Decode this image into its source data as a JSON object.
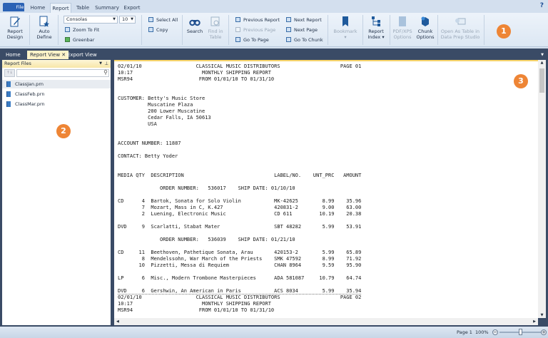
{
  "menu_tabs": [
    "File",
    "Home",
    "Report",
    "Table",
    "Summary",
    "Export"
  ],
  "active_menu_tab": "Report",
  "help_label": "?",
  "ribbon": {
    "report_design": "Report Design",
    "auto_define": "Auto Define",
    "font_name": "Consolas",
    "font_size": "10",
    "zoom_to_fit": "Zoom To Fit",
    "greenbar": "Greenbar",
    "select_all": "Select All",
    "copy": "Copy",
    "search": "Search",
    "find_in_table": "Find in Table",
    "previous_report": "Previous Report",
    "previous_page": "Previous Page",
    "go_to_page": "Go To Page",
    "next_report": "Next Report",
    "next_page": "Next Page",
    "go_to_chunk": "Go To Chunk",
    "bookmark": "Bookmark",
    "report_index": "Report Index",
    "pdf_xps_options": "PDF/XPS Options",
    "chunk_options": "Chunk Options",
    "open_as_table": "Open As Table in Data Prep Studio"
  },
  "doc_tabs": [
    "Home",
    "Report View",
    "Export View"
  ],
  "active_doc_tab": "Report View",
  "left_panel": {
    "title": "Report Files",
    "search_placeholder": "",
    "files": [
      "ClassJan.prn",
      "ClassFeb.prn",
      "ClassMar.prn"
    ],
    "selected": "ClassJan.prn"
  },
  "report": {
    "header": {
      "date": "02/01/10",
      "time": "10:17",
      "code": "MSR94",
      "company": "CLASSICAL MUSIC DISTRIBUTORS",
      "title": "MONTHLY SHIPPING REPORT",
      "range": "FROM 01/01/10 TO 01/31/10",
      "page1": "PAGE 01",
      "page2": "PAGE 02"
    },
    "customer_label": "CUSTOMER:",
    "customer": [
      "Betty's Music Store",
      "Muscatine Plaza",
      "200 Lower Muscatine",
      "Cedar Falls, IA 50613",
      "USA"
    ],
    "account": "ACCOUNT NUMBER: 11887",
    "contact": "CONTACT: Betty Yoder",
    "columns": {
      "media": "MEDIA",
      "qty": "QTY",
      "description": "DESCRIPTION",
      "label": "LABEL/NO.",
      "price": "UNT_PRC",
      "amount": "AMOUNT"
    },
    "orders": [
      {
        "order_number": "536017",
        "ship_date": "01/10/10",
        "groups": [
          {
            "media": "CD",
            "items": [
              {
                "qty": "4",
                "desc": "Bartok, Sonata for Solo Violin",
                "label": "MK-42625",
                "price": "8.99",
                "amount": "35.96"
              },
              {
                "qty": "7",
                "desc": "Mozart, Mass in C, K.427",
                "label": "420831-2",
                "price": "9.00",
                "amount": "63.00"
              },
              {
                "qty": "2",
                "desc": "Luening, Electronic Music",
                "label": "CD 611",
                "price": "10.19",
                "amount": "20.38"
              }
            ]
          },
          {
            "media": "DVD",
            "items": [
              {
                "qty": "9",
                "desc": "Scarlatti, Stabat Mater",
                "label": "SBT 48282",
                "price": "5.99",
                "amount": "53.91"
              }
            ]
          }
        ]
      },
      {
        "order_number": "536039",
        "ship_date": "01/21/10",
        "groups": [
          {
            "media": "CD",
            "items": [
              {
                "qty": "11",
                "desc": "Beethoven, Pathetique Sonata, Arau",
                "label": "420153-2",
                "price": "5.99",
                "amount": "65.89"
              },
              {
                "qty": "8",
                "desc": "Mendelssohn, War March of the Priests",
                "label": "SMK 47592",
                "price": "8.99",
                "amount": "71.92"
              },
              {
                "qty": "10",
                "desc": "Pizzetti, Messa di Requiem",
                "label": "CHAN 8964",
                "price": "9.59",
                "amount": "95.90"
              }
            ]
          },
          {
            "media": "LP",
            "items": [
              {
                "qty": "6",
                "desc": "Misc., Modern Trombone Masterpieces",
                "label": "ADA 581087",
                "price": "10.79",
                "amount": "64.74"
              }
            ]
          },
          {
            "media": "DVD",
            "items": [
              {
                "qty": "6",
                "desc": "Gershwin, An American in Paris",
                "label": "ACS 8034",
                "price": "5.99",
                "amount": "35.94"
              }
            ]
          }
        ]
      }
    ],
    "order_label": "ORDER NUMBER:",
    "ship_label": "SHIP DATE:"
  },
  "status": {
    "page": "Page 1",
    "zoom": "100%",
    "zoom_value": 100
  },
  "badges": [
    "1",
    "2",
    "3"
  ],
  "colors": {
    "accent": "#2b62b5",
    "badge": "#ee8535",
    "frame": "#3a4b66"
  }
}
